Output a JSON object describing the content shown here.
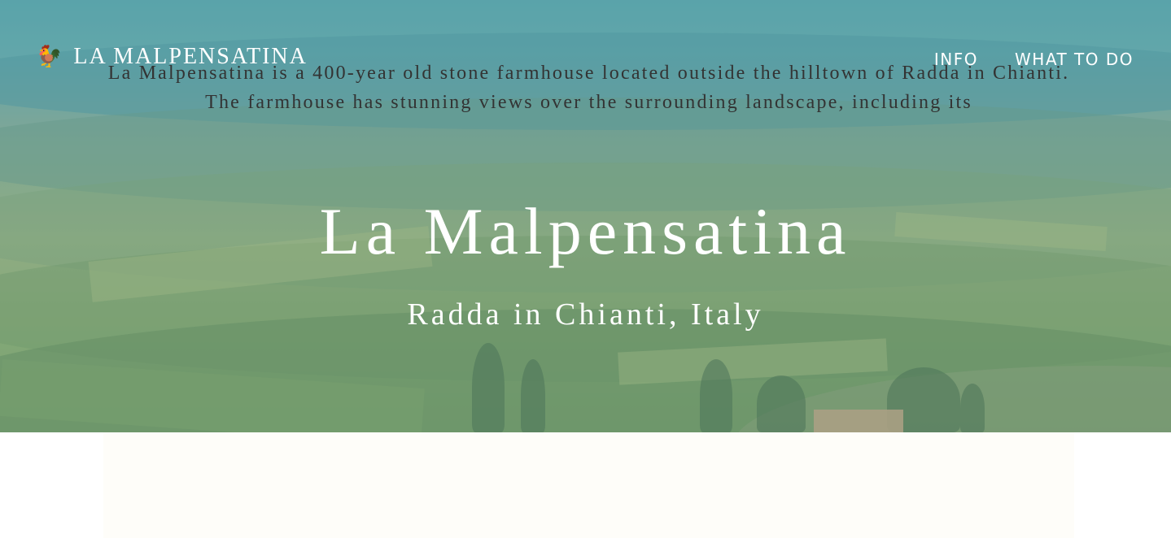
{
  "navbar": {
    "brand_icon": "rooster-icon",
    "brand_name": "LA MALPENSATINA",
    "links": [
      "INFO",
      "WHAT TO DO"
    ]
  },
  "hero": {
    "title": "La Malpensatina",
    "subtitle": "Radda in Chianti, Italy"
  },
  "content": {
    "intro": "La Malpensatina is a 400-year old stone farmhouse located outside the hilltown of Radda in Chianti. The farmhouse has stunning views over the surrounding landscape, including its"
  }
}
